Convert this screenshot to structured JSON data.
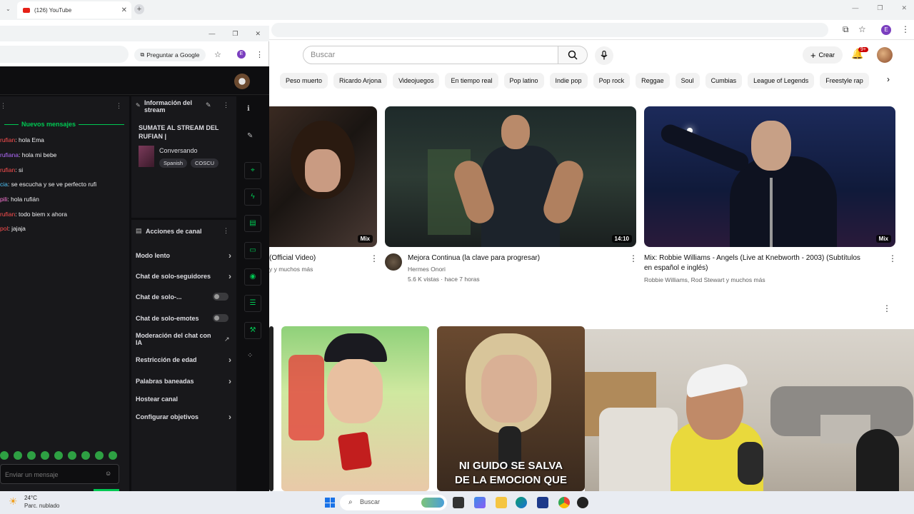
{
  "browser": {
    "tab_title": "(126) YouTube",
    "tab_close": "✕",
    "new_tab": "+",
    "window_controls": [
      "—",
      "❐",
      "✕"
    ],
    "profile_initial": "E"
  },
  "youtube": {
    "search_placeholder": "Buscar",
    "create_label": "Crear",
    "notif_badge": "9+",
    "chips": [
      "Peso muerto",
      "Ricardo Arjona",
      "Videojuegos",
      "En tiempo real",
      "Pop latino",
      "Indie pop",
      "Pop rock",
      "Reggae",
      "Soul",
      "Cumbias",
      "League of Legends",
      "Freestyle rap"
    ],
    "videos": [
      {
        "title": "(Official Video)",
        "meta": "y y muchos más",
        "badge": "Mix"
      },
      {
        "title": "Mejora Continua (la clave para progresar)",
        "channel": "Hermes Onori",
        "meta": "5.6 K vistas · hace 7 horas",
        "badge": "14:10"
      },
      {
        "title_line1": "Mix: Robbie Williams - Angels  (Live at Knebworth - 2003) (Subtítulos",
        "title_line2": "en español e inglés)",
        "meta": "Robbie Williams, Rod Stewart y muchos más",
        "badge": "Mix"
      }
    ],
    "caption_line1": "NI GUIDO SE SALVA",
    "caption_line2": "DE LA EMOCION QUE"
  },
  "twitch_window": {
    "ask_google": "Preguntar a Google",
    "window_controls": [
      "—",
      "❐",
      "✕"
    ],
    "chat": {
      "new_messages": "Nuevos mensajes",
      "lines": [
        {
          "name": "rufian",
          "name_color": "#ff4f4f",
          "text": ": hola Ema"
        },
        {
          "name": "rufiana",
          "name_color": "#b36bff",
          "text": ": hola mi bebe"
        },
        {
          "name": "rufian",
          "name_color": "#ff4f4f",
          "text": ": si"
        },
        {
          "name": "cia",
          "name_color": "#4fc3f7",
          "text": ": se escucha y se ve perfecto rufi"
        },
        {
          "name": "pili",
          "name_color": "#ff7ad9",
          "text": ": hola rufián"
        },
        {
          "name": "rufian",
          "name_color": "#ff4f4f",
          "text": ": todo biem x ahora"
        },
        {
          "name": "pol",
          "name_color": "#ff4f4f",
          "text": ": jajaja"
        }
      ],
      "input_placeholder": "Enviar un mensaje"
    },
    "stream_info": {
      "header": "Información del stream",
      "title": "SUMATE AL STREAM DEL RUFIAN |",
      "category": "Conversando",
      "tags": [
        "Spanish",
        "COSCU"
      ]
    },
    "channel_actions": {
      "header": "Acciones de canal",
      "items": [
        {
          "label": "Modo lento",
          "kind": "chevron"
        },
        {
          "label": "Chat de solo-seguidores",
          "kind": "chevron"
        },
        {
          "label": "Chat de solo-...",
          "kind": "toggle"
        },
        {
          "label": "Chat de solo-emotes",
          "kind": "toggle"
        },
        {
          "label": "Moderación del chat con IA",
          "kind": "external"
        },
        {
          "label": "Restricción de edad",
          "kind": "chevron"
        },
        {
          "label": "Palabras baneadas",
          "kind": "chevron"
        },
        {
          "label": "Hostear canal",
          "kind": "none"
        },
        {
          "label": "Configurar objetivos",
          "kind": "chevron"
        }
      ]
    }
  },
  "taskbar": {
    "temperature": "24°C",
    "weather": "Parc. nublado",
    "search_label": "Buscar"
  }
}
